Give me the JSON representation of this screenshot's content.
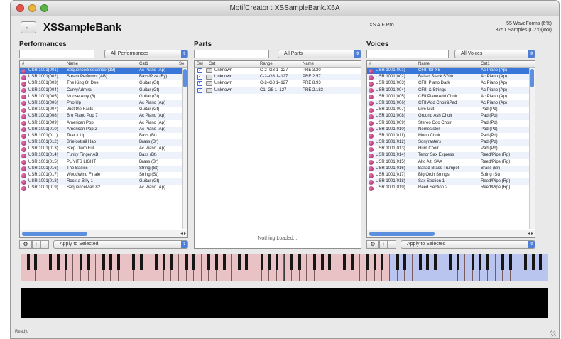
{
  "window": {
    "title": "MotifCreator : XSSampleBank.X6A"
  },
  "header": {
    "back_label": "←",
    "bank_name": "XSSampleBank",
    "status": "XS AIF Pro",
    "info_line1": "55 WaveForms (6%)",
    "info_line2": "3751 Samples (CZx)(xxx)"
  },
  "performances": {
    "title": "Performances",
    "filter_value": "",
    "category_filter": "All Performances",
    "columns": [
      "#",
      "Name",
      "Cat1",
      "Se"
    ],
    "rows": [
      {
        "id": "USR 1001(001)",
        "name": "Sequence/Sequencer(18)",
        "cat": "Ac Piano (Ap)",
        "selected": true
      },
      {
        "id": "USR 1001(002)",
        "name": "Steam Performs (AB)",
        "cat": "Bass/Pize (By)",
        "selected": false
      },
      {
        "id": "USR 1001(003)",
        "name": "The King Of Dee",
        "cat": "Guitar (Gt)",
        "selected": false
      },
      {
        "id": "USR 1001(004)",
        "name": "CurvyAdmiral",
        "cat": "Guitar (Gt)",
        "selected": false
      },
      {
        "id": "USR 1001(005)",
        "name": "Moose Amy (8)",
        "cat": "Guitar (Gt)",
        "selected": false
      },
      {
        "id": "USR 1001(006)",
        "name": "Pno Up",
        "cat": "Ac Piano (Ap)",
        "selected": false
      },
      {
        "id": "USR 1001(007)",
        "name": "Just the Facts",
        "cat": "Guitar (Gt)",
        "selected": false
      },
      {
        "id": "USR 1001(008)",
        "name": "Bro Piano Pop 7",
        "cat": "Ac Piano (Ap)",
        "selected": false
      },
      {
        "id": "USR 1001(009)",
        "name": "American Pop",
        "cat": "Ac Piano (Ap)",
        "selected": false
      },
      {
        "id": "USR 1001(010)",
        "name": "American Pop 2",
        "cat": "Ac Piano (Ap)",
        "selected": false
      },
      {
        "id": "USR 1001(011)",
        "name": "Tear It Up",
        "cat": "Bass (Bt)",
        "selected": false
      },
      {
        "id": "USR 1001(012)",
        "name": "Briefoxtrail Hap",
        "cat": "Brass (Br)",
        "selected": false
      },
      {
        "id": "USR 1001(013)",
        "name": "Step Diam Full",
        "cat": "Ac Piano (Ap)",
        "selected": false
      },
      {
        "id": "USR 1001(014)",
        "name": "Funky Finger AB",
        "cat": "Bass (Bt)",
        "selected": false
      },
      {
        "id": "USR 1001(015)",
        "name": "PUYITS LIGHT",
        "cat": "Brass (Br)",
        "selected": false
      },
      {
        "id": "USR 1001(016)",
        "name": "The Basics",
        "cat": "String (St)",
        "selected": false
      },
      {
        "id": "USR 1001(017)",
        "name": "WoodWind Finale",
        "cat": "String (St)",
        "selected": false
      },
      {
        "id": "USR 1001(018)",
        "name": "Rock-a-Billy 1",
        "cat": "Guitar (Gt)",
        "selected": false
      },
      {
        "id": "USR 1001(019)",
        "name": "SequenceMan 82",
        "cat": "Ac Piano (Ap)",
        "selected": false
      }
    ],
    "apply_label": "Apply to Selected"
  },
  "parts": {
    "title": "Parts",
    "filter_value": "",
    "category_filter": "All Parts",
    "columns": [
      "Sel",
      "Cat",
      "Range",
      "Name"
    ],
    "rows": [
      {
        "check": "✓",
        "cat": "Unknown",
        "range": "C-2–G8 1–127",
        "name": "PRE 3.20"
      },
      {
        "check": "✓",
        "cat": "Unknown",
        "range": "C-2–G8 1–127",
        "name": "PRE 2.57"
      },
      {
        "check": "✓",
        "cat": "Unknown",
        "range": "C-2–G8 1–127",
        "name": "PRE 8.93"
      },
      {
        "check": "✓",
        "cat": "Unknown",
        "range": "C1–G8 1–127",
        "name": "PRE 2.183"
      }
    ],
    "empty_message": "Nothing Loaded..."
  },
  "voices": {
    "title": "Voices",
    "filter_value": "",
    "category_filter": "All Voices",
    "columns": [
      "#",
      "Name",
      "Cat1"
    ],
    "rows": [
      {
        "id": "USR 1001(001)",
        "name": "CFIII for XS",
        "cat": "Ac Piano (Ap)",
        "selected": true
      },
      {
        "id": "USR 1001(002)",
        "name": "Ballad Stack S700",
        "cat": "Ac Piano (Ap)",
        "selected": false
      },
      {
        "id": "USR 1001(003)",
        "name": "CFIII Piano Dark",
        "cat": "Ac Piano (Ap)",
        "selected": false
      },
      {
        "id": "USR 1001(004)",
        "name": "CFIII & Strings",
        "cat": "Ac Piano (Ap)",
        "selected": false
      },
      {
        "id": "USR 1001(005)",
        "name": "CFIIIPianoAdd Choir",
        "cat": "Ac Piano (Ap)",
        "selected": false
      },
      {
        "id": "USR 1001(006)",
        "name": "CFIIIAdd Choir&Pad",
        "cat": "Ac Piano (Ap)",
        "selected": false
      },
      {
        "id": "USR 1001(007)",
        "name": "Live Gut",
        "cat": "Pad (Pd)",
        "selected": false
      },
      {
        "id": "USR 1001(008)",
        "name": "Ground Ash Choir",
        "cat": "Pad (Pd)",
        "selected": false
      },
      {
        "id": "USR 1001(009)",
        "name": "Stereo Ooo Choir",
        "cat": "Pad (Pd)",
        "selected": false
      },
      {
        "id": "USR 1001(010)",
        "name": "Nemesister",
        "cat": "Pad (Pd)",
        "selected": false
      },
      {
        "id": "USR 1001(011)",
        "name": "Moon Choir",
        "cat": "Pad (Pd)",
        "selected": false
      },
      {
        "id": "USR 1001(012)",
        "name": "Sonyrasters",
        "cat": "Pad (Pd)",
        "selected": false
      },
      {
        "id": "USR 1001(013)",
        "name": "Hum Choir",
        "cat": "Pad (Pd)",
        "selected": false
      },
      {
        "id": "USR 1001(014)",
        "name": "Tenor Sax Express",
        "cat": "Reed/Pipe (Rp)",
        "selected": false
      },
      {
        "id": "USR 1001(015)",
        "name": "Alto Alt. SAX",
        "cat": "Reed/Pipe (Rp)",
        "selected": false
      },
      {
        "id": "USR 1001(016)",
        "name": "Ballad Brass Trumpet",
        "cat": "Brass (Br)",
        "selected": false
      },
      {
        "id": "USR 1001(017)",
        "name": "Big Orch Strings",
        "cat": "String (St)",
        "selected": false
      },
      {
        "id": "USR 1001(018)",
        "name": "Sax Section 1",
        "cat": "Reed/Pipe (Rp)",
        "selected": false
      },
      {
        "id": "USR 1001(019)",
        "name": "Reed Section 2",
        "cat": "Reed/Pipe (Rp)",
        "selected": false
      }
    ],
    "apply_label": "Apply to Selected"
  },
  "keyboard": {
    "octaves": 10,
    "range_highlight_from_octave": 7
  },
  "statusbar": {
    "text": "Ready."
  },
  "icons": {
    "gear": "gear-icon",
    "add": "plus-icon",
    "remove": "minus-icon"
  },
  "colors": {
    "selection": "#3877d9",
    "voice_dot": "#c0357a",
    "key_pink": "#e8c2c4",
    "key_blue": "#b9c5ee"
  }
}
